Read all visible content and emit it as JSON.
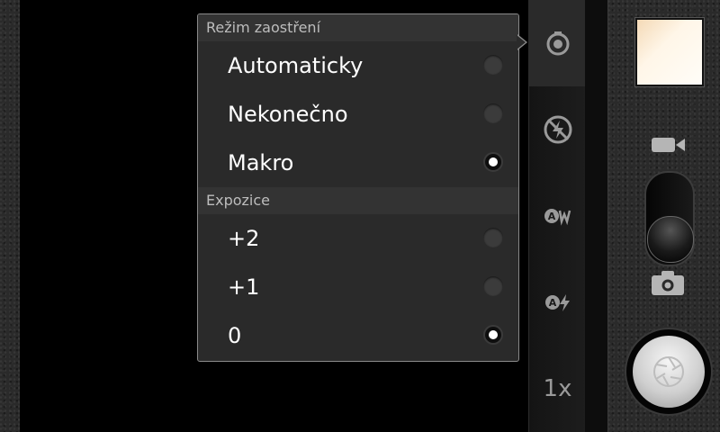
{
  "menu": {
    "focus_header": "Režim zaostření",
    "focus_options": [
      {
        "label": "Automaticky",
        "selected": false
      },
      {
        "label": "Nekonečno",
        "selected": false
      },
      {
        "label": "Makro",
        "selected": true
      }
    ],
    "exposure_header": "Expozice",
    "exposure_options": [
      {
        "label": "+2",
        "selected": false
      },
      {
        "label": "+1",
        "selected": false
      },
      {
        "label": "0",
        "selected": true
      }
    ]
  },
  "settings_bar": {
    "items": [
      {
        "icon": "focus-mode-icon",
        "active": true
      },
      {
        "icon": "flash-off-icon",
        "active": false
      },
      {
        "icon": "white-balance-auto-icon",
        "active": false
      },
      {
        "icon": "auto-flash-icon",
        "active": false
      }
    ],
    "zoom_label": "1x"
  },
  "controls": {
    "mode": "camera",
    "icons": [
      "video-camera-icon",
      "camera-icon",
      "shutter-icon"
    ]
  },
  "colors": {
    "menu_bg": "#2a2a2a",
    "menu_border": "#8a8a8a",
    "header_text": "#bdbdbd",
    "item_text": "#ffffff",
    "icon_gray": "#9a9a9a"
  }
}
